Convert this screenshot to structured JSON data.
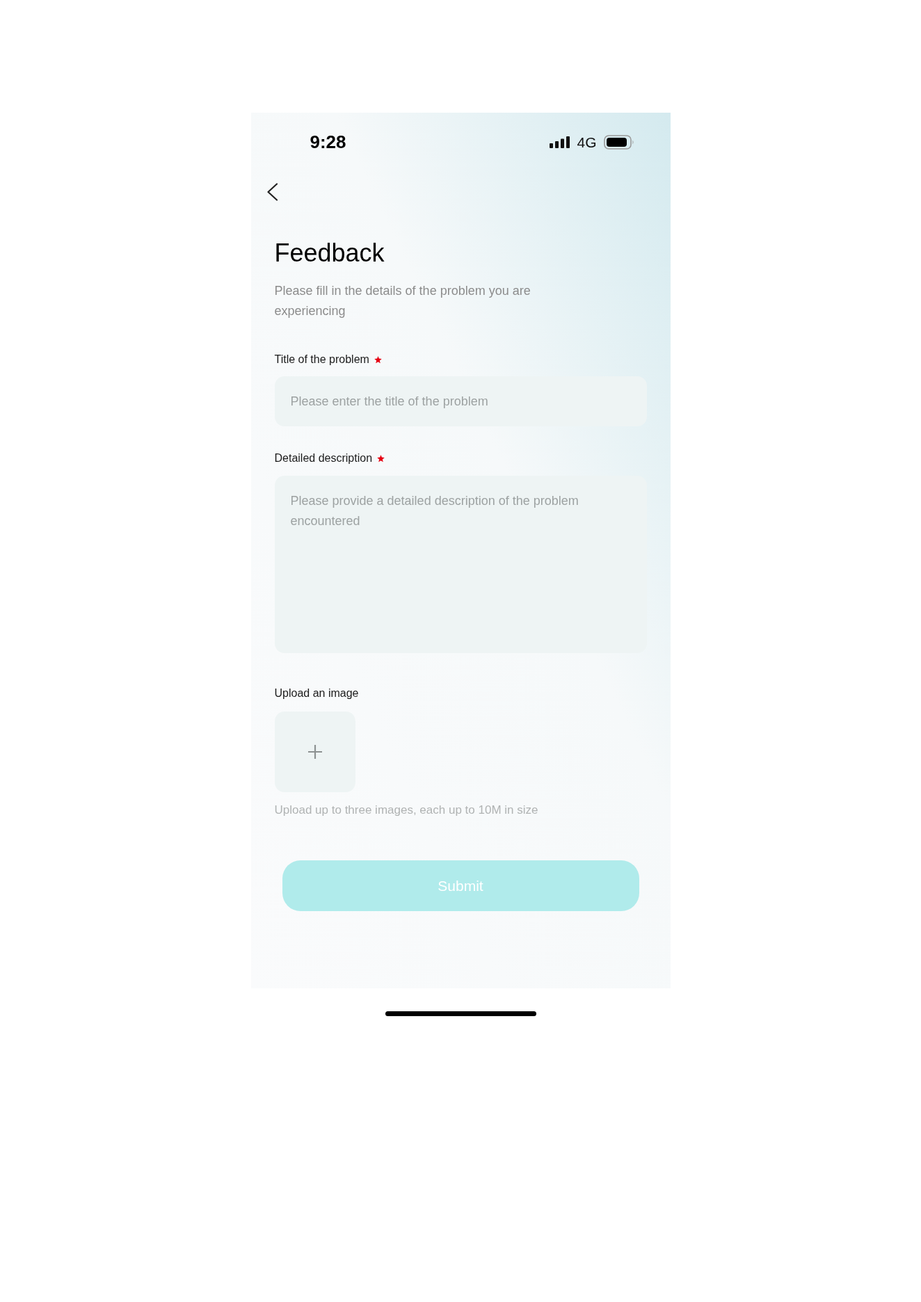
{
  "status_bar": {
    "time": "9:28",
    "network": "4G"
  },
  "page": {
    "title": "Feedback",
    "subtitle": "Please fill in the details of the problem you are experiencing"
  },
  "fields": [
    {
      "kind": "input",
      "label": "Title of the problem",
      "required": true,
      "placeholder": "Please enter the title of the problem"
    },
    {
      "kind": "textarea",
      "label": "Detailed description",
      "required": true,
      "placeholder": "Please provide a detailed description of the problem encountered"
    }
  ],
  "upload": {
    "label": "Upload an image",
    "hint": "Upload up to three images, each up to 10M in size"
  },
  "submit": {
    "label": "Submit",
    "disabled": true
  }
}
